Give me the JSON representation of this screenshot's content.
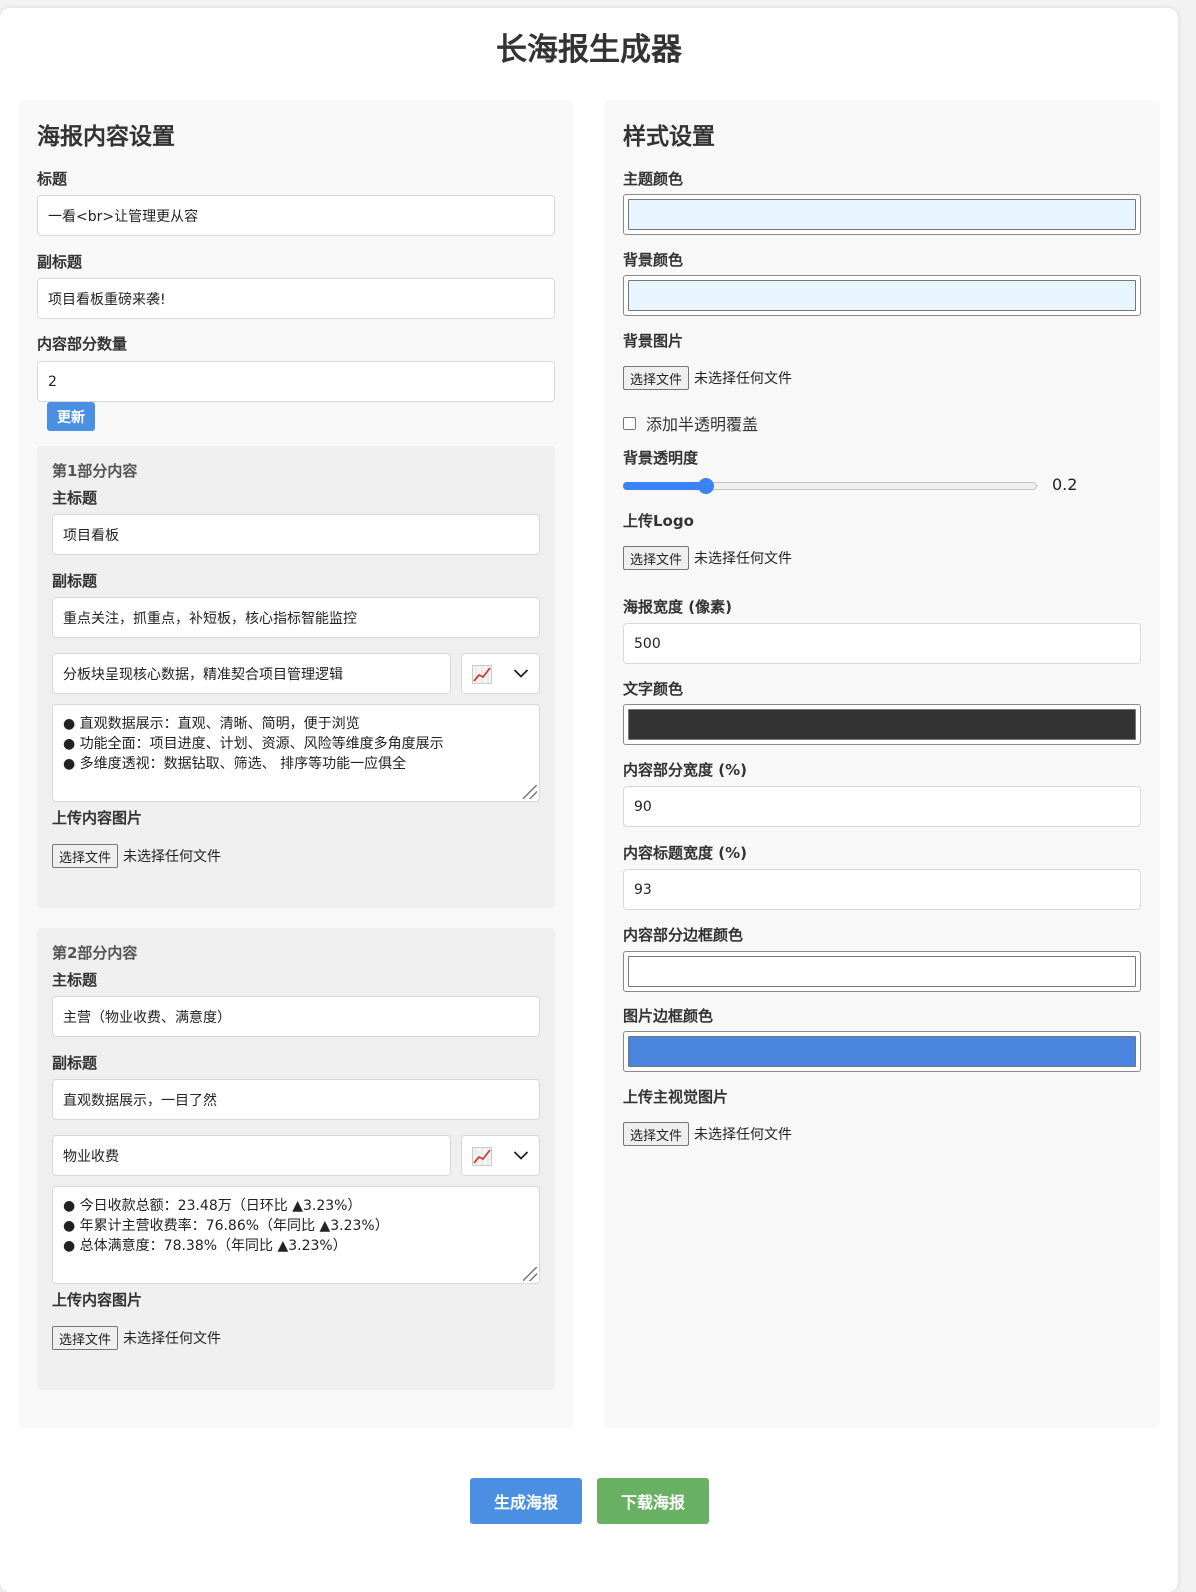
{
  "app": {
    "title": "长海报生成器"
  },
  "content_panel": {
    "heading": "海报内容设置",
    "title_label": "标题",
    "title_value": "一看<br>让管理更从容",
    "subtitle_label": "副标题",
    "subtitle_value": "项目看板重磅来袭!",
    "count_label": "内容部分数量",
    "count_value": "2",
    "update_label": "更新",
    "sections": [
      {
        "heading": "第1部分内容",
        "main_title_label": "主标题",
        "main_title_value": "项目看板",
        "subtitle_label": "副标题",
        "subtitle_value": "重点关注，抓重点，补短板，核心指标智能监控",
        "item_title_value": "分板块呈现核心数据，精准契合项目管理逻辑",
        "icon_option": "chart-increasing-icon",
        "bullets": [
          "● 直观数据展示：直观、清晰、简明，便于浏览",
          "● 功能全面：项目进度、计划、资源、风险等维度多角度展示",
          "● 多维度透视：数据钻取、筛选、 排序等功能一应俱全"
        ],
        "image_label": "上传内容图片",
        "file_button": "选择文件",
        "file_status": "未选择任何文件"
      },
      {
        "heading": "第2部分内容",
        "main_title_label": "主标题",
        "main_title_value": "主营（物业收费、满意度）",
        "subtitle_label": "副标题",
        "subtitle_value": "直观数据展示，一目了然",
        "item_title_value": "物业收费",
        "icon_option": "chart-increasing-icon",
        "bullets": [
          "● 今日收款总额：23.48万（日环比 ▲3.23%）",
          "● 年累计主营收费率：76.86%（年同比 ▲3.23%）",
          "● 总体满意度：78.38%（年同比 ▲3.23%）"
        ],
        "image_label": "上传内容图片",
        "file_button": "选择文件",
        "file_status": "未选择任何文件"
      }
    ]
  },
  "style_panel": {
    "heading": "样式设置",
    "theme_color_label": "主题颜色",
    "theme_color": "#e8f4ff",
    "bg_color_label": "背景颜色",
    "bg_color": "#e8f4ff",
    "bg_image_label": "背景图片",
    "file_button": "选择文件",
    "file_status": "未选择任何文件",
    "overlay_label": "添加半透明覆盖",
    "overlay_checked": false,
    "opacity_label": "背景透明度",
    "opacity_value": "0.2",
    "logo_label": "上传Logo",
    "width_label": "海报宽度 (像素)",
    "width_value": "500",
    "text_color_label": "文字颜色",
    "text_color": "#333333",
    "section_width_label": "内容部分宽度 (%)",
    "section_width_value": "90",
    "title_width_label": "内容标题宽度 (%)",
    "title_width_value": "93",
    "border_color_label": "内容部分边框颜色",
    "border_color": "#ffffff",
    "image_border_label": "图片边框颜色",
    "image_border_color": "#4a86e0",
    "main_visual_label": "上传主视觉图片"
  },
  "actions": {
    "generate_label": "生成海报",
    "generate_color": "#4a8fe2",
    "download_label": "下载海报",
    "download_color": "#68b062"
  }
}
